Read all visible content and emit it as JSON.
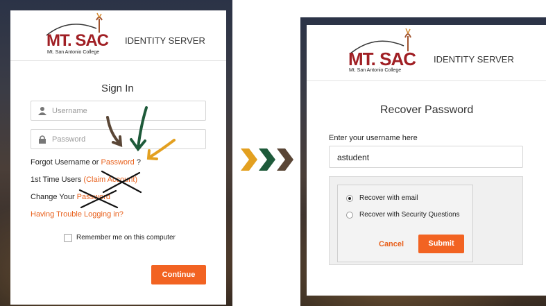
{
  "logo": {
    "brand": "MT. SAC",
    "subtitle": "Mt. San Antonio College"
  },
  "header": {
    "identity_server": "IDENTITY SERVER"
  },
  "signin": {
    "title": "Sign In",
    "username_placeholder": "Username",
    "password_placeholder": "Password",
    "forgot_prefix": "Forgot Username or ",
    "forgot_link": "Password",
    "forgot_suffix": " ?",
    "first_time_prefix": "1st Time Users ",
    "first_time_link": "(Claim Account)",
    "change_prefix": "Change Your ",
    "change_link": "Password",
    "trouble_link": "Having Trouble Logging in?",
    "remember_label": "Remember me on this computer",
    "continue_label": "Continue"
  },
  "recover": {
    "title": "Recover Password",
    "username_label": "Enter your username here",
    "username_value": "astudent",
    "option_email": "Recover with email",
    "option_questions": "Recover with Security Questions",
    "selected_option": "email",
    "cancel_label": "Cancel",
    "submit_label": "Submit"
  },
  "annotations": {
    "arrow_colors": [
      "#5a4636",
      "#1e5a3a",
      "#e3a020"
    ],
    "chevron_colors": [
      "#e3a020",
      "#1e5a3a",
      "#5a4636"
    ]
  },
  "colors": {
    "accent": "#f26322",
    "brand_red": "#a01f24"
  }
}
